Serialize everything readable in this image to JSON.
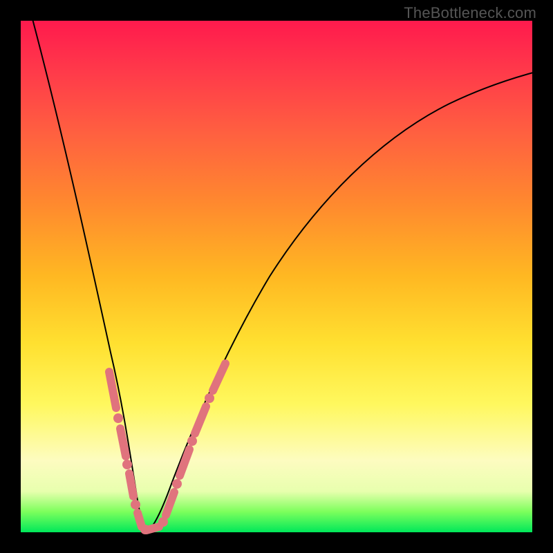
{
  "watermark": "TheBottleneck.com",
  "chart_data": {
    "type": "line",
    "title": "",
    "xlabel": "",
    "ylabel": "",
    "xrange": [
      0,
      100
    ],
    "yrange": [
      0,
      100
    ],
    "grid": false,
    "legend": false,
    "notes": "V-shaped bottleneck curve on rainbow gradient; x ~ component ratio, y ~ bottleneck %. Vertex near x≈23, y≈0. Pink bead segments overlay the curve near the bottom.",
    "series": [
      {
        "name": "bottleneck-curve",
        "x": [
          0,
          3,
          6,
          9,
          12,
          15,
          18,
          20,
          22,
          23,
          25,
          27,
          30,
          35,
          40,
          50,
          60,
          70,
          80,
          90,
          100
        ],
        "values": [
          100,
          90,
          79,
          67,
          54,
          41,
          27,
          16,
          5,
          0,
          3,
          10,
          21,
          35,
          46,
          61,
          70,
          76,
          80,
          83,
          85
        ]
      }
    ],
    "highlight_segments": [
      {
        "x_start": 14,
        "x_end": 17,
        "side": "left"
      },
      {
        "x_start": 17,
        "x_end": 18,
        "side": "left",
        "dot": true
      },
      {
        "x_start": 18,
        "x_end": 21,
        "side": "left"
      },
      {
        "x_start": 21,
        "x_end": 22,
        "side": "left",
        "dot": true
      },
      {
        "x_start": 22,
        "x_end": 25,
        "side": "bottom"
      },
      {
        "x_start": 25,
        "x_end": 26,
        "side": "right",
        "dot": true
      },
      {
        "x_start": 26,
        "x_end": 29,
        "side": "right"
      },
      {
        "x_start": 29,
        "x_end": 30,
        "side": "right",
        "dot": true
      },
      {
        "x_start": 30,
        "x_end": 33,
        "side": "right"
      }
    ]
  }
}
